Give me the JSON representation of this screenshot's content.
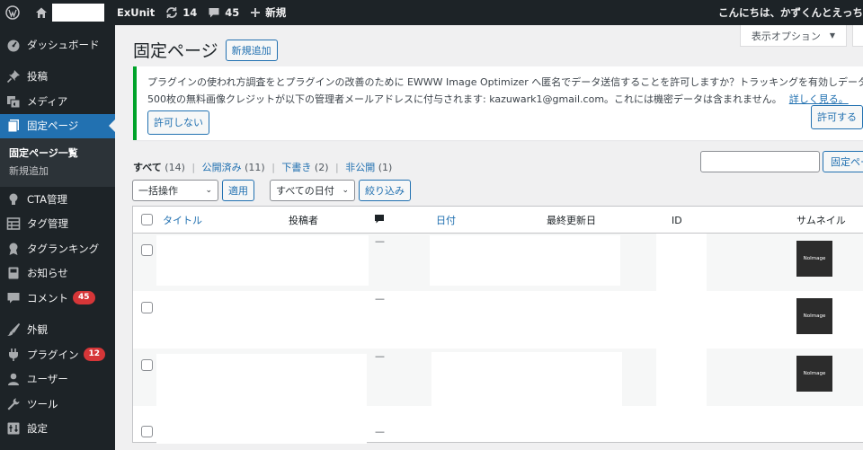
{
  "adminbar": {
    "site_name": "ExUnit",
    "updates_count": "14",
    "comments_count": "45",
    "new_label": "新規",
    "greeting": "こんにちは、かずくんとえっち"
  },
  "sidebar": {
    "items": [
      {
        "label": "ダッシュボード",
        "icon": "dashboard-icon"
      },
      {
        "label": "投稿",
        "icon": "pin-icon"
      },
      {
        "label": "メディア",
        "icon": "media-icon"
      },
      {
        "label": "固定ページ",
        "icon": "page-icon"
      },
      {
        "label": "CTA管理",
        "icon": "lightbulb-icon"
      },
      {
        "label": "タグ管理",
        "icon": "tag-manager-icon"
      },
      {
        "label": "タグランキング",
        "icon": "award-icon"
      },
      {
        "label": "お知らせ",
        "icon": "book-icon"
      },
      {
        "label": "コメント",
        "icon": "comment-icon",
        "badge": "45"
      },
      {
        "label": "外観",
        "icon": "brush-icon"
      },
      {
        "label": "プラグイン",
        "icon": "plugin-icon",
        "badge": "12"
      },
      {
        "label": "ユーザー",
        "icon": "user-icon"
      },
      {
        "label": "ツール",
        "icon": "wrench-icon"
      },
      {
        "label": "設定",
        "icon": "settings-icon"
      }
    ],
    "submenu": [
      "固定ページ一覧",
      "新規追加"
    ]
  },
  "header": {
    "title": "固定ページ",
    "add_new": "新規追加",
    "screen_options": "表示オプション"
  },
  "notice": {
    "line1": "プラグインの使われ方調査をとプラグインの改善のために EWWW Image Optimizer へ匿名でデータ送信することを許可しますか？トラッキングを有効しデータを送信す",
    "line2_prefix": "500枚の無料画像クレジットが以下の管理者メールアドレスに付与されます: ",
    "email": "kazuwark1@gmail.com",
    "line2_suffix": "。これには機密データは含まれません。",
    "learn_more": "詳しく見る。",
    "allow": "許可する",
    "deny": "許可しない"
  },
  "filters": {
    "all": "すべて",
    "all_count": "(14)",
    "published": "公開済み",
    "published_count": "(11)",
    "draft": "下書き",
    "draft_count": "(2)",
    "private": "非公開",
    "private_count": "(1)",
    "search_button": "固定ペー",
    "bulk_action": "一括操作",
    "apply": "適用",
    "all_dates": "すべての日付",
    "filter": "絞り込み"
  },
  "table": {
    "columns": {
      "title": "タイトル",
      "author": "投稿者",
      "date": "日付",
      "modified": "最終更新日",
      "id": "ID",
      "thumbnail": "サムネイル"
    },
    "dash": "—",
    "thumb_label": "NoImage"
  },
  "colors": {
    "adminbar_bg": "#1d2327",
    "accent": "#2271b1",
    "notice_border": "#00a32a",
    "badge": "#d63638"
  }
}
